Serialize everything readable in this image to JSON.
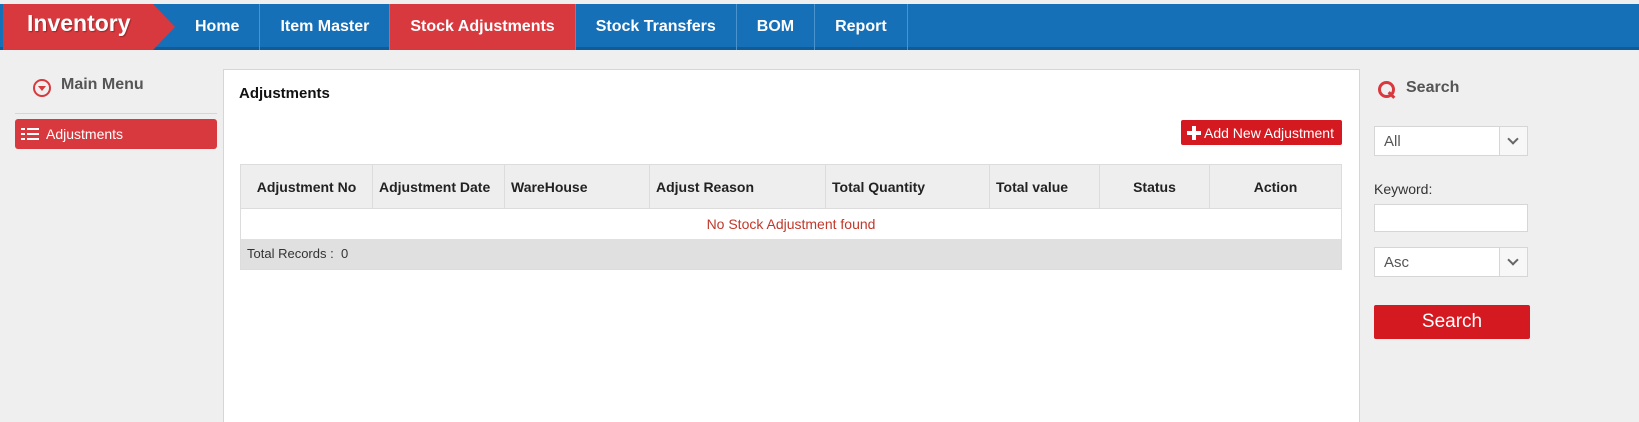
{
  "app": {
    "brand": "Inventory"
  },
  "nav": [
    {
      "label": "Home",
      "active": false
    },
    {
      "label": "Item Master",
      "active": false
    },
    {
      "label": "Stock Adjustments",
      "active": true
    },
    {
      "label": "Stock Transfers",
      "active": false
    },
    {
      "label": "BOM",
      "active": false
    },
    {
      "label": "Report",
      "active": false
    }
  ],
  "sidebar": {
    "title": "Main Menu",
    "items": [
      {
        "label": "Adjustments",
        "active": true
      }
    ]
  },
  "main": {
    "title": "Adjustments",
    "add_button": "Add New Adjustment",
    "columns": [
      "Adjustment No",
      "Adjustment Date",
      "WareHouse",
      "Adjust Reason",
      "Total Quantity",
      "Total value",
      "Status",
      "Action"
    ],
    "empty_message": "No Stock Adjustment found",
    "total_label": "Total Records :",
    "total_count": "0"
  },
  "search": {
    "title": "Search",
    "filter_selected": "All",
    "keyword_label": "Keyword:",
    "keyword_value": "",
    "order_selected": "Asc",
    "button": "Search"
  },
  "colors": {
    "primary_blue": "#1670b8",
    "accent_red": "#d8393e",
    "button_red": "#d41920"
  }
}
